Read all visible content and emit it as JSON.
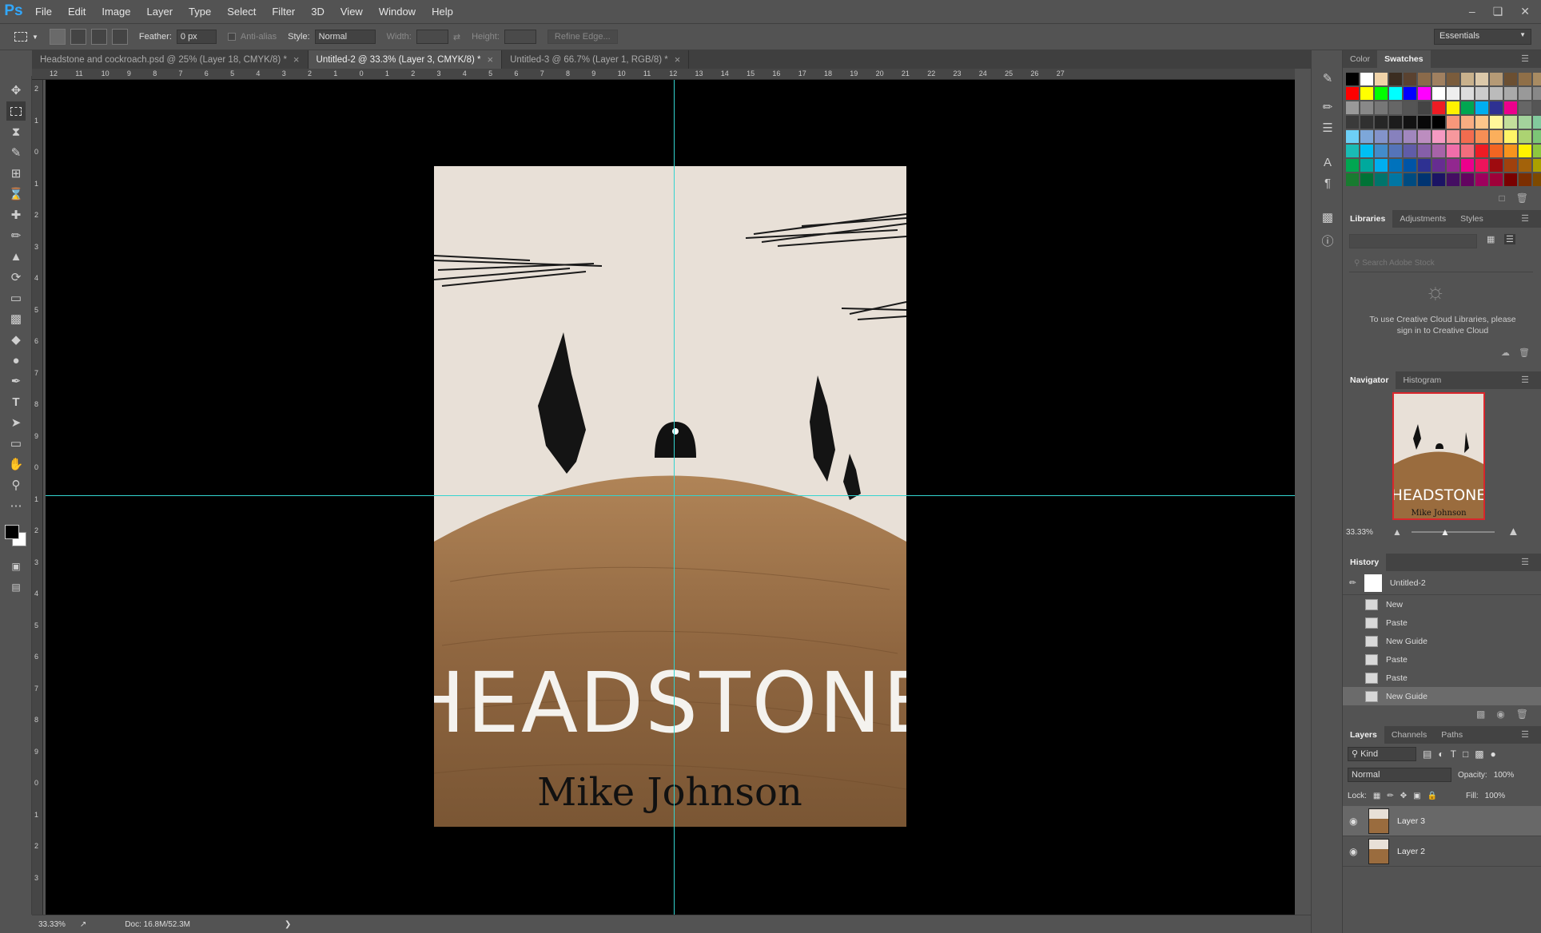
{
  "app": {
    "logo": "Ps"
  },
  "menu": [
    "File",
    "Edit",
    "Image",
    "Layer",
    "Type",
    "Select",
    "Filter",
    "3D",
    "View",
    "Window",
    "Help"
  ],
  "options": {
    "feather_label": "Feather:",
    "feather_value": "0 px",
    "antialias_label": "Anti-alias",
    "style_label": "Style:",
    "style_value": "Normal",
    "width_label": "Width:",
    "height_label": "Height:",
    "refine_label": "Refine Edge...",
    "workspace": "Essentials"
  },
  "tabs": [
    {
      "label": "Headstone and cockroach.psd @ 25% (Layer 18, CMYK/8) *",
      "active": false
    },
    {
      "label": "Untitled-2 @ 33.3% (Layer 3, CMYK/8) *",
      "active": true
    },
    {
      "label": "Untitled-3 @ 66.7% (Layer 1, RGB/8) *",
      "active": false
    }
  ],
  "ruler_top": [
    "12",
    "11",
    "10",
    "9",
    "8",
    "7",
    "6",
    "5",
    "4",
    "3",
    "2",
    "1",
    "0",
    "1",
    "2",
    "3",
    "4",
    "5",
    "6",
    "7",
    "8",
    "9",
    "10",
    "11",
    "12",
    "13",
    "14",
    "15",
    "16",
    "17",
    "18",
    "19",
    "20",
    "21",
    "22",
    "23",
    "24",
    "25",
    "26",
    "27"
  ],
  "ruler_left": [
    "2",
    "1",
    "0",
    "1",
    "2",
    "3",
    "4",
    "5",
    "6",
    "7",
    "8",
    "9",
    "0",
    "1",
    "2",
    "3",
    "4",
    "5",
    "6",
    "7",
    "8",
    "9",
    "0",
    "1",
    "2",
    "3"
  ],
  "cover": {
    "title": "HEADSTONE",
    "author": "Mike Johnson"
  },
  "status": {
    "zoom": "33.33%",
    "doc": "Doc: 16.8M/52.3M"
  },
  "panels": {
    "color_tabs": [
      "Color",
      "Swatches"
    ],
    "lib_tabs": [
      "Libraries",
      "Adjustments",
      "Styles"
    ],
    "lib_search": "Search Adobe Stock",
    "lib_message": "To use Creative Cloud Libraries, please sign in to Creative Cloud",
    "nav_tabs": [
      "Navigator",
      "Histogram"
    ],
    "nav_zoom": "33.33%",
    "nav_thumb_title": "HEADSTONE",
    "nav_thumb_author": "Mike Johnson",
    "history_title": "History",
    "history_snapshot": "Untitled-2",
    "history_items": [
      "New",
      "Paste",
      "New Guide",
      "Paste",
      "Paste",
      "New Guide"
    ],
    "layers_tabs": [
      "Layers",
      "Channels",
      "Paths"
    ],
    "layers_kind": "Kind",
    "blend_mode": "Normal",
    "opacity_label": "Opacity:",
    "opacity_value": "100%",
    "lock_label": "Lock:",
    "fill_label": "Fill:",
    "fill_value": "100%",
    "layers": [
      "Layer 3",
      "Layer 2"
    ]
  },
  "swatch_colors": [
    "#000000",
    "#ffffff",
    "#f0d3a8",
    "#3b2d21",
    "#5a4230",
    "#8a6a4a",
    "#a08060",
    "#7a5c3c",
    "#c9b18c",
    "#dcc9aa",
    "#b59a76",
    "#6b4f32",
    "#8f6f48",
    "#a88b62",
    "#c4a37a",
    "#ff0000",
    "#ffff00",
    "#00ff00",
    "#00ffff",
    "#0000ff",
    "#ff00ff",
    "#ffffff",
    "#eeeeee",
    "#dddddd",
    "#cccccc",
    "#bbbbbb",
    "#aaaaaa",
    "#999999",
    "#888888",
    "#777777",
    "#999999",
    "#888888",
    "#777777",
    "#666666",
    "#555555",
    "#444444",
    "#ed1c24",
    "#fff200",
    "#00a651",
    "#00aeef",
    "#2e3192",
    "#ec008c",
    "#666666",
    "#555555",
    "#444444",
    "#3a3a3a",
    "#303030",
    "#262626",
    "#1c1c1c",
    "#121212",
    "#080808",
    "#000000",
    "#f7977a",
    "#f9ad81",
    "#fdc68a",
    "#fff79a",
    "#c4df9b",
    "#a3d39c",
    "#82ca9d",
    "#7bcdc8",
    "#6dcff6",
    "#7da7d9",
    "#8393ca",
    "#8781bd",
    "#a187be",
    "#bc8dbf",
    "#f49ac2",
    "#f6989d",
    "#f26c4f",
    "#f68e55",
    "#fbaf5c",
    "#fff467",
    "#acd372",
    "#7cc576",
    "#3bb878",
    "#1abbb4",
    "#00bff3",
    "#438cca",
    "#5574b9",
    "#605ca8",
    "#855fa8",
    "#a763a8",
    "#f06eaa",
    "#f26d7d",
    "#ed1c24",
    "#f26522",
    "#f7941d",
    "#fff200",
    "#8dc73f",
    "#39b54a",
    "#00a651",
    "#00a99d",
    "#00aeef",
    "#0072bc",
    "#0054a6",
    "#2e3192",
    "#662d91",
    "#92278f",
    "#ec008c",
    "#ed145b",
    "#9e0b0f",
    "#a0410d",
    "#a3620a",
    "#aba000",
    "#598527",
    "#197b30",
    "#007236",
    "#00746b",
    "#0076a3",
    "#004b80",
    "#003471",
    "#1b1464",
    "#440e62",
    "#630460",
    "#9e005d",
    "#9e0039",
    "#790000",
    "#7b2e00",
    "#7d4900",
    "#827b00"
  ]
}
